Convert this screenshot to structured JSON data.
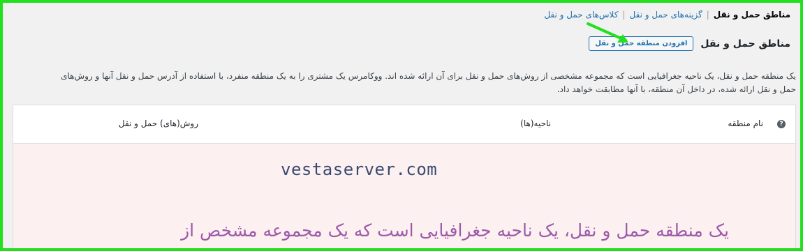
{
  "subnav": {
    "current": "مناطق حمل و نقل",
    "options": "گزینه‌های حمل و نقل",
    "classes": "کلاس‌های حمل و نقل"
  },
  "page_title": "مناطق حمل و نقل",
  "add_zone_button": "افزودن منطقه حمل و نقل",
  "description": {
    "line1": "یک منطقه حمل و نقل، یک ناحیه جغرافیایی است که مجموعه مشخصی از روش‌های حمل و نقل برای آن ارائه شده اند. ووکامرس یک مشتری را به یک منطقه منفرد، با استفاده از آدرس حمل و نقل آنها و روش‌های",
    "line2": "حمل و نقل ارائه شده، در داخل آن منطقه، با آنها مطابقت خواهد داد."
  },
  "table": {
    "help_icon": "?",
    "columns": [
      "نام منطقه",
      "ناحیه(ها)",
      "روش(های) حمل و نقل"
    ]
  },
  "watermark": "vestaserver.com",
  "overlay_caption": "یک منطقه حمل و نقل، یک ناحیه جغرافیایی است که یک مجموعه مشخص از",
  "colors": {
    "frame_border": "#22e01e",
    "link": "#2271b1",
    "arrow": "#22e01e",
    "caption": "#9c5aa9"
  }
}
